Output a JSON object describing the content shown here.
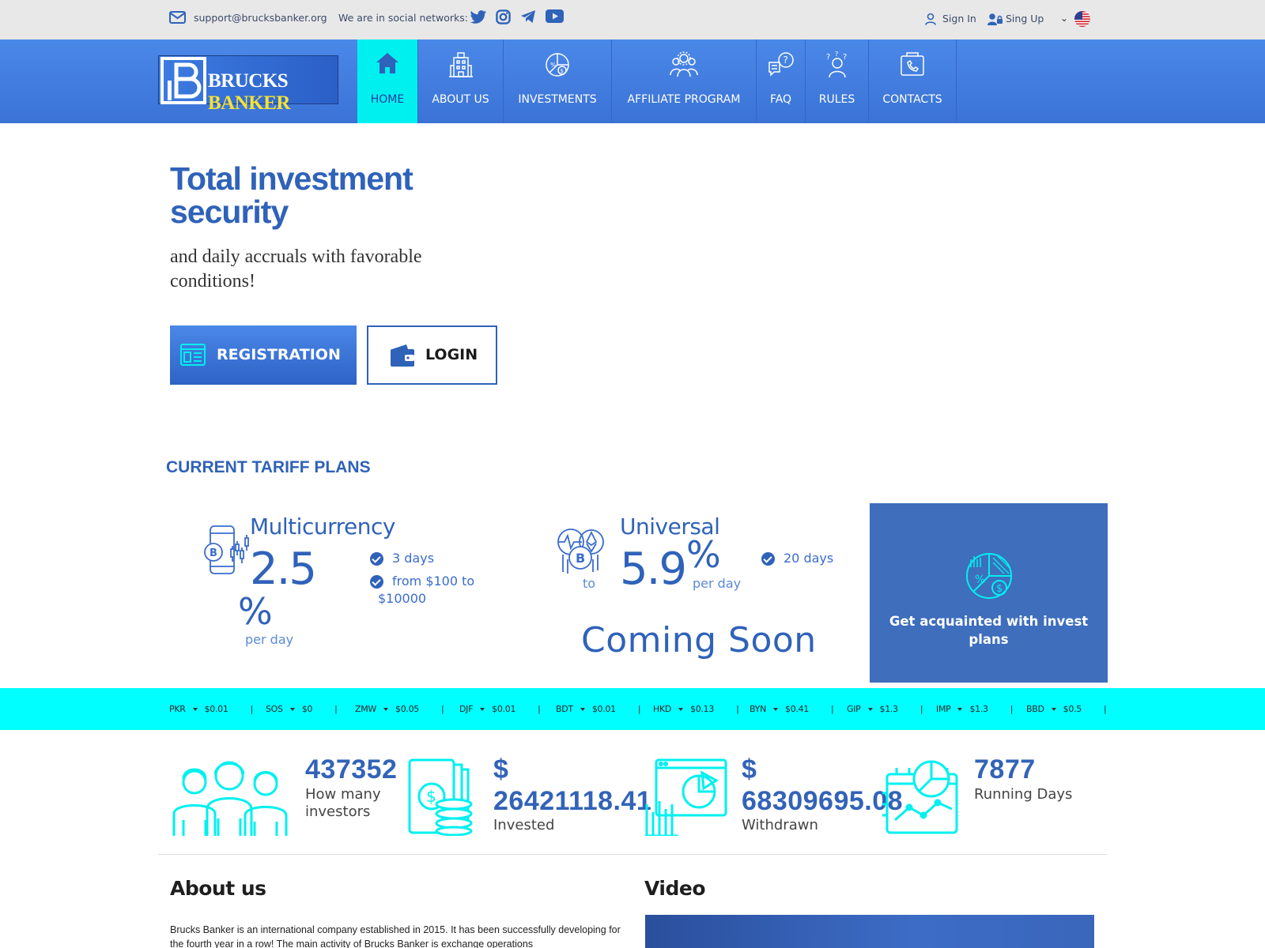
{
  "topbar": {
    "email": "support@brucksbanker.org",
    "social_label": "We are in social networks:",
    "social": [
      "twitter-icon",
      "instagram-icon",
      "telegram-icon",
      "youtube-icon"
    ],
    "sign_in": "Sign In",
    "sign_up": "Sing Up",
    "language_flag": "us-flag-icon"
  },
  "logo": {
    "word1": "BRUCKS",
    "word2": "BANKER"
  },
  "nav": [
    {
      "label": "HOME",
      "icon": "home-icon",
      "active": true
    },
    {
      "label": "ABOUT US",
      "icon": "building-icon"
    },
    {
      "label": "INVESTMENTS",
      "icon": "investment-chart-icon"
    },
    {
      "label": "AFFILIATE PROGRAM",
      "icon": "people-group-icon"
    },
    {
      "label": "FAQ",
      "icon": "question-chat-icon"
    },
    {
      "label": "RULES",
      "icon": "person-question-icon"
    },
    {
      "label": "CONTACTS",
      "icon": "phone-contact-icon"
    }
  ],
  "hero": {
    "title": "Total investment security",
    "subtitle": "and daily accruals with favorable conditions!",
    "registration": "REGISTRATION",
    "login": "LOGIN"
  },
  "tariff": {
    "title": "CURRENT TARIFF PLANS",
    "plans": [
      {
        "name": "Multicurrency",
        "rate": "2.5",
        "pct": "%",
        "per_day": "per day",
        "features": [
          "3 days",
          "from $100 to $10000"
        ]
      },
      {
        "name": "Universal",
        "to": "to",
        "rate": "5.9",
        "pct": "%",
        "per_day": "per day",
        "features": [
          "20 days"
        ],
        "coming_soon": "Coming Soon"
      }
    ],
    "promo": "Get acquainted with invest plans"
  },
  "ticker": [
    {
      "code": "PKR",
      "value": "$0.01"
    },
    {
      "code": "SOS",
      "value": "$0"
    },
    {
      "code": "ZMW",
      "value": "$0.05"
    },
    {
      "code": "DJF",
      "value": "$0.01"
    },
    {
      "code": "BDT",
      "value": "$0.01"
    },
    {
      "code": "HKD",
      "value": "$0.13"
    },
    {
      "code": "BYN",
      "value": "$0.41"
    },
    {
      "code": "GIP",
      "value": "$1.3"
    },
    {
      "code": "IMP",
      "value": "$1.3"
    },
    {
      "code": "BBD",
      "value": "$0.5"
    }
  ],
  "stats": [
    {
      "number": "437352",
      "label": "How many investors",
      "icon": "investors-icon"
    },
    {
      "number_prefix": "$",
      "number": "26421118.41",
      "label": "Invested",
      "icon": "money-stack-icon"
    },
    {
      "number_prefix": "$",
      "number": "68309695.08",
      "label": "Withdrawn",
      "icon": "analytics-screen-icon"
    },
    {
      "number": "7877",
      "label": "Running Days",
      "icon": "calendar-chart-icon"
    }
  ],
  "about": {
    "title": "About us",
    "text": "Brucks Banker is an international company established in 2015. It has been successfully developing for the fourth year in a row! The main activity of Brucks Banker is exchange operations"
  },
  "video": {
    "title": "Video"
  },
  "colors": {
    "primary": "#2f62b9",
    "nav": "#3b73d6",
    "accent": "#00ffff",
    "promo": "#3e6ebc"
  }
}
